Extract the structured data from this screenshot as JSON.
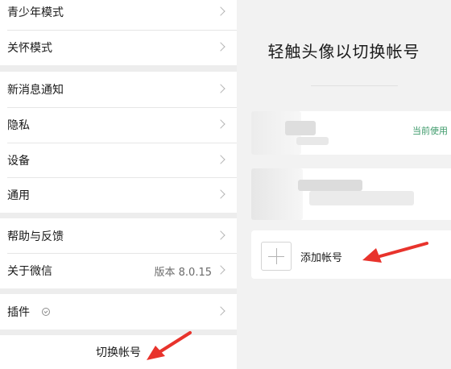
{
  "settings": {
    "groups": [
      {
        "rows": [
          {
            "label": "青少年模式"
          },
          {
            "label": "关怀模式"
          }
        ]
      },
      {
        "rows": [
          {
            "label": "新消息通知"
          },
          {
            "label": "隐私"
          },
          {
            "label": "设备"
          },
          {
            "label": "通用"
          }
        ]
      },
      {
        "rows": [
          {
            "label": "帮助与反馈"
          },
          {
            "label": "关于微信",
            "value": "版本 8.0.15"
          }
        ]
      },
      {
        "rows": [
          {
            "label": "插件"
          }
        ]
      }
    ],
    "switch_account_label": "切换帐号"
  },
  "switch_panel": {
    "title": "轻触头像以切换帐号",
    "accounts": [
      {
        "status": "当前使用"
      }
    ],
    "add_account_label": "添加帐号"
  },
  "colors": {
    "arrow": "#e8332c",
    "current_tag": "#3d9a6a",
    "background": "#ededed"
  }
}
